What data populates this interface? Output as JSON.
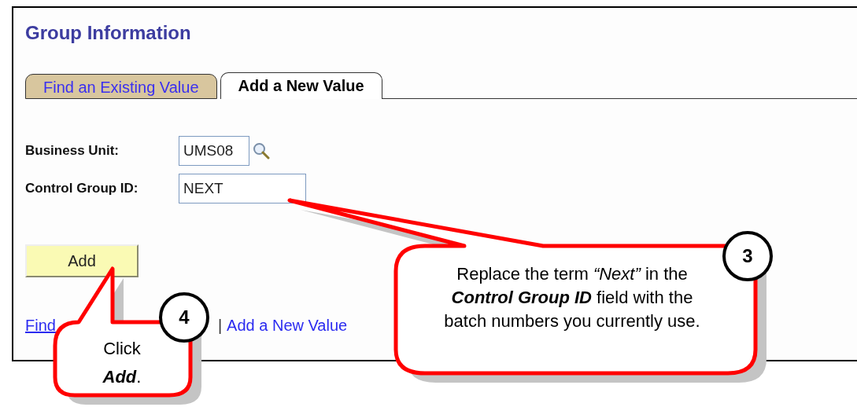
{
  "page": {
    "title": "Group Information"
  },
  "tabs": [
    {
      "label": "Find an Existing Value",
      "selected": false
    },
    {
      "label": "Add a New Value",
      "selected": true
    }
  ],
  "fields": [
    {
      "label": "Business Unit:",
      "value": "UMS08",
      "lookup": true
    },
    {
      "label": "Control Group ID:",
      "value": "NEXT",
      "lookup": false
    }
  ],
  "add_button": "Add",
  "footer_links": [
    {
      "label": "Find",
      "underlined": true
    },
    {
      "label": "Add a New Value",
      "underlined": false
    }
  ],
  "footer_separator": "|",
  "callouts": [
    {
      "step": "3",
      "text": "Replace the term *“Next”* in the **Control Group ID** field with the batch numbers you currently use."
    },
    {
      "step": "4",
      "text": "Click **Add**."
    }
  ]
}
